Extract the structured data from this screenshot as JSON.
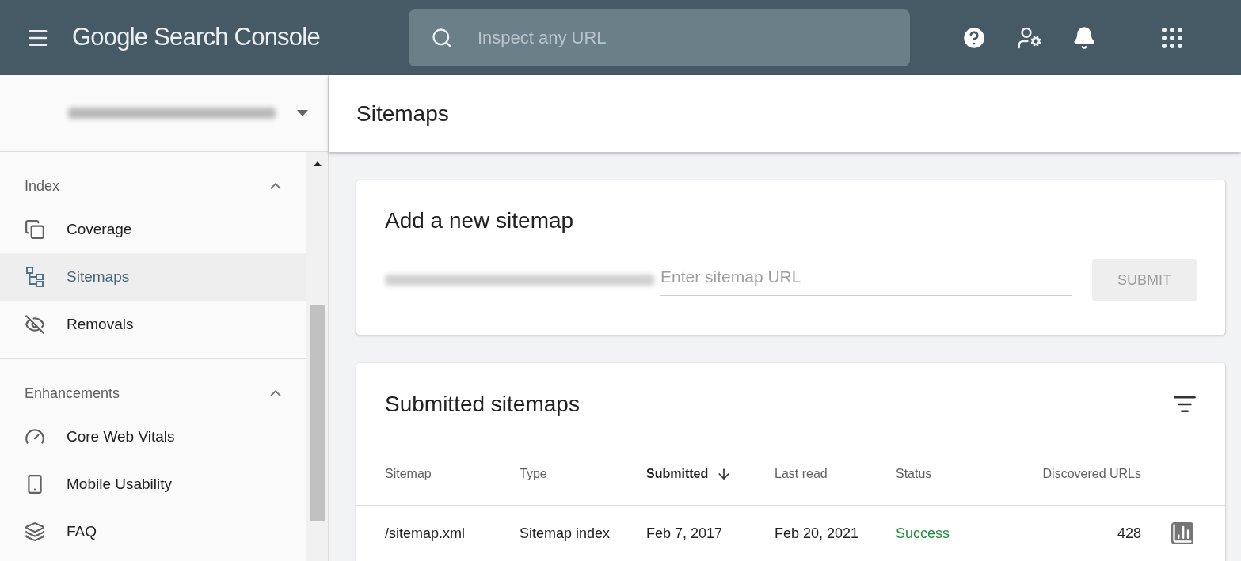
{
  "app_title": "Google Search Console",
  "search": {
    "placeholder": "Inspect any URL"
  },
  "page_title": "Sitemaps",
  "sidebar": {
    "sections": [
      {
        "title": "Index",
        "expanded": true,
        "items": [
          {
            "label": "Coverage",
            "selected": false
          },
          {
            "label": "Sitemaps",
            "selected": true
          },
          {
            "label": "Removals",
            "selected": false
          }
        ]
      },
      {
        "title": "Enhancements",
        "expanded": true,
        "items": [
          {
            "label": "Core Web Vitals",
            "selected": false
          },
          {
            "label": "Mobile Usability",
            "selected": false
          },
          {
            "label": "FAQ",
            "selected": false
          }
        ]
      }
    ]
  },
  "add_sitemap": {
    "title": "Add a new sitemap",
    "placeholder": "Enter sitemap URL",
    "button": "SUBMIT",
    "disabled": true
  },
  "submitted": {
    "title": "Submitted sitemaps",
    "columns": [
      {
        "label": "Sitemap",
        "sorted": false
      },
      {
        "label": "Type",
        "sorted": false
      },
      {
        "label": "Submitted",
        "sorted": true
      },
      {
        "label": "Last read",
        "sorted": false
      },
      {
        "label": "Status",
        "sorted": false
      },
      {
        "label": "Discovered URLs",
        "sorted": false
      }
    ],
    "rows": [
      {
        "sitemap": "/sitemap.xml",
        "type": "Sitemap index",
        "submitted": "Feb 7, 2017",
        "last_read": "Feb 20, 2021",
        "status": "Success",
        "discovered": "428"
      }
    ]
  }
}
